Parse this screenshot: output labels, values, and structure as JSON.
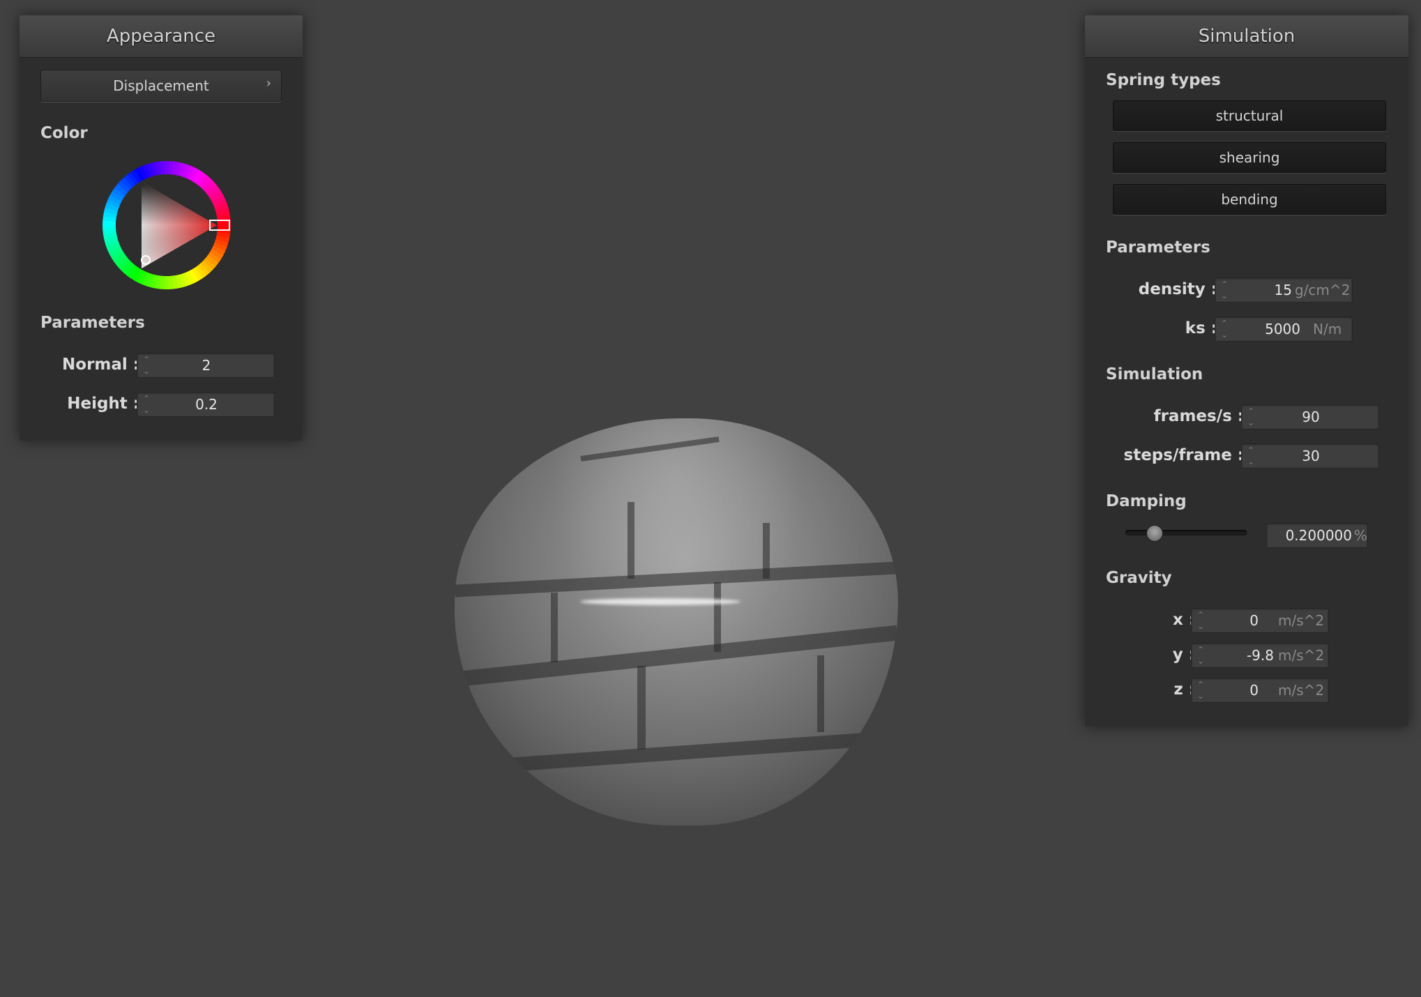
{
  "appearance": {
    "title": "Appearance",
    "mode_button": "Displacement",
    "color_label": "Color",
    "color_hue": "#e02020",
    "parameters_label": "Parameters",
    "normal_label": "Normal :",
    "normal_value": "2",
    "height_label": "Height :",
    "height_value": "0.2"
  },
  "simulation": {
    "title": "Simulation",
    "spring_types_label": "Spring types",
    "spring_buttons": [
      "structural",
      "shearing",
      "bending"
    ],
    "parameters_label": "Parameters",
    "density_label": "density :",
    "density_value": "15",
    "density_unit": "g/cm^2",
    "ks_label": "ks :",
    "ks_value": "5000",
    "ks_unit": "N/m",
    "simulation_label": "Simulation",
    "fps_label": "frames/s :",
    "fps_value": "90",
    "steps_label": "steps/frame :",
    "steps_value": "30",
    "damping_label": "Damping",
    "damping_value": "0.200000",
    "damping_unit": "%",
    "damping_level": 0.2,
    "gravity_label": "Gravity",
    "gx_label": "x :",
    "gx_value": "0",
    "gy_label": "y :",
    "gy_value": "-9.8",
    "gz_label": "z :",
    "gz_value": "0",
    "gravity_unit": "m/s^2"
  },
  "colors": {
    "background": "#414141",
    "panel": "#2d2d2d",
    "accent": "#e02020"
  }
}
